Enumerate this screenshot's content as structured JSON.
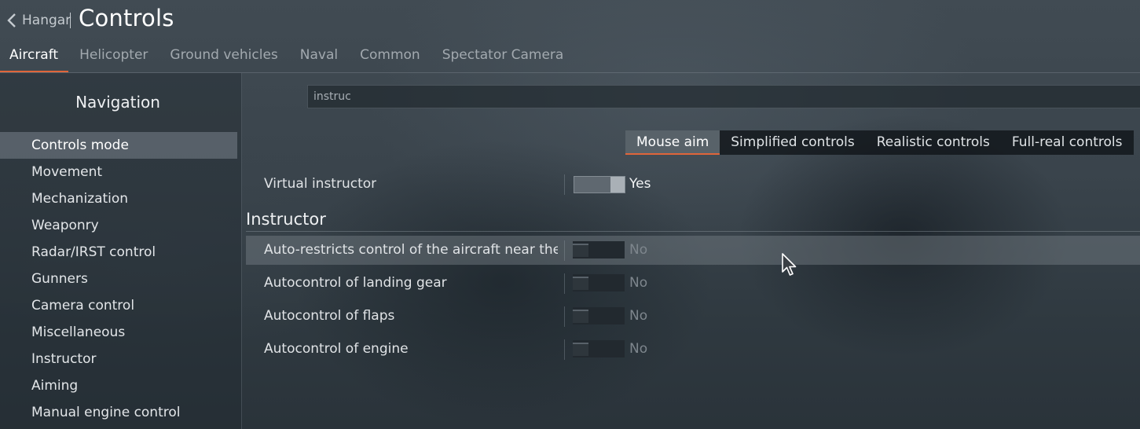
{
  "header": {
    "back_label": "Hangar",
    "title": "Controls"
  },
  "tabs": [
    {
      "label": "Aircraft",
      "active": true
    },
    {
      "label": "Helicopter"
    },
    {
      "label": "Ground vehicles"
    },
    {
      "label": "Naval"
    },
    {
      "label": "Common"
    },
    {
      "label": "Spectator Camera"
    }
  ],
  "navigation": {
    "title": "Navigation",
    "items": [
      {
        "label": "Controls mode",
        "active": true
      },
      {
        "label": "Movement"
      },
      {
        "label": "Mechanization"
      },
      {
        "label": "Weaponry"
      },
      {
        "label": "Radar/IRST control"
      },
      {
        "label": "Gunners"
      },
      {
        "label": "Camera control"
      },
      {
        "label": "Miscellaneous"
      },
      {
        "label": "Instructor"
      },
      {
        "label": "Aiming"
      },
      {
        "label": "Manual engine control"
      }
    ]
  },
  "search": {
    "value": "instruc"
  },
  "modes": [
    {
      "label": "Mouse aim",
      "active": true
    },
    {
      "label": "Simplified controls"
    },
    {
      "label": "Realistic controls"
    },
    {
      "label": "Full-real controls"
    }
  ],
  "settings": {
    "virtual_instructor": {
      "label": "Virtual instructor",
      "value": "Yes"
    },
    "section_title": "Instructor",
    "rows": [
      {
        "label": "Auto-restricts control of the aircraft near the gro",
        "value": "No"
      },
      {
        "label": "Autocontrol of landing gear",
        "value": "No"
      },
      {
        "label": "Autocontrol of flaps",
        "value": "No"
      },
      {
        "label": "Autocontrol of engine",
        "value": "No"
      }
    ]
  },
  "colors": {
    "accent": "#e0653a"
  },
  "icons": {
    "back": "chevron-left-icon",
    "cursor": "mouse-pointer-icon"
  }
}
